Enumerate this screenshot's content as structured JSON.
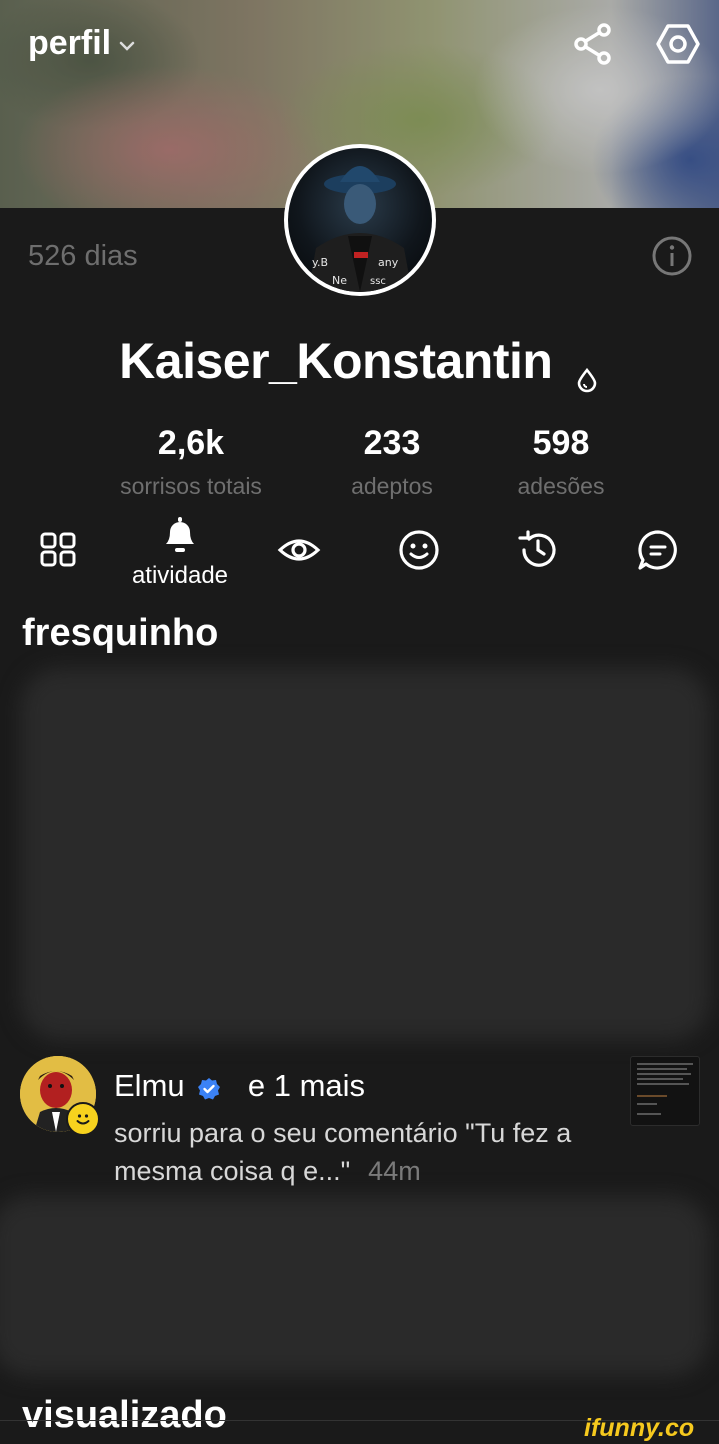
{
  "header": {
    "title": "perfil",
    "icons": [
      "chevron-down-icon",
      "share-icon",
      "settings-icon"
    ]
  },
  "profile": {
    "days": "526 dias",
    "username": "Kaiser_Konstantin",
    "stats": [
      {
        "value": "2,6k",
        "label": "sorrisos totais"
      },
      {
        "value": "233",
        "label": "adeptos"
      },
      {
        "value": "598",
        "label": "adesões"
      }
    ]
  },
  "tabs": {
    "items": [
      "grid-icon",
      "bell-icon",
      "eye-icon",
      "smile-icon",
      "history-icon",
      "chat-icon"
    ],
    "active_label": "atividade"
  },
  "sections": {
    "fresh": "fresquinho",
    "seen": "visualizado"
  },
  "notification": {
    "name": "Elmu",
    "more": "e 1 mais",
    "text": "sorriu para o seu comentário \"Tu fez a mesma coisa q e...\"",
    "time": "44m"
  },
  "watermark": "ifunny.co",
  "colors": {
    "background": "#1a1a1a",
    "muted_text": "#6f6f6f",
    "verified": "#3b82f6",
    "watermark": "#f6c91e"
  }
}
